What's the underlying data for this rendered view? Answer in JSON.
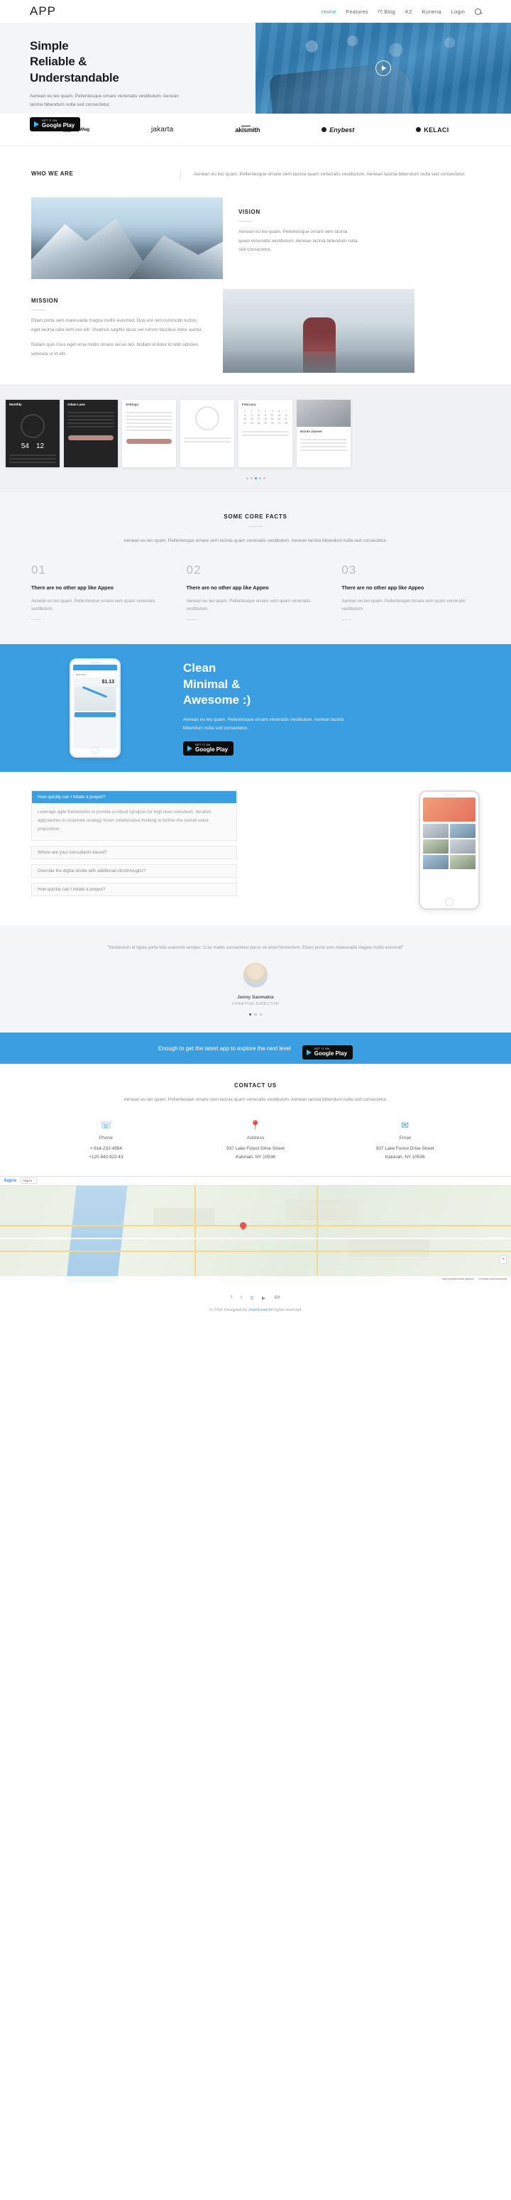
{
  "header": {
    "logo": "APP",
    "nav": [
      {
        "label": "Home",
        "active": true
      },
      {
        "label": "Features",
        "active": false
      },
      {
        "label": "Blog",
        "active": false,
        "icon": "joomla-icon"
      },
      {
        "label": "K2",
        "active": false
      },
      {
        "label": "Kunena",
        "active": false
      },
      {
        "label": "Login",
        "active": false
      }
    ],
    "search_icon": "search-icon"
  },
  "hero": {
    "title_line1": "Simple",
    "title_line2": "Reliable &",
    "title_line3": "Understandable",
    "paragraph": "Aenean eu leo quam. Pellentesque ornare venenatis vestibulum. Aenean lacinia bibendum nulla sed consectetur.",
    "store_badge": {
      "small": "GET IT ON",
      "big": "Google Play"
    },
    "play_button": "play-button"
  },
  "brands": [
    {
      "name": "TechMag",
      "mark": "TM"
    },
    {
      "name": "jakarta"
    },
    {
      "name": "akismith"
    },
    {
      "name": "Enybest"
    },
    {
      "name": "KELACI"
    }
  ],
  "who": {
    "heading": "WHO WE ARE",
    "paragraph": "Aenean eu leo quam. Pellentesque ornare sem lacinia quam venenatis vestibulum. Aenean lacinia bibendum nulla sed consectetur."
  },
  "vision": {
    "heading": "VISION",
    "paragraph": "Aenean eu leo quam. Pellentesque ornare sem lacinia quam venenatis vestibulum. Aenean lacinia bibendum nulla sed consectetur."
  },
  "mission": {
    "heading": "MISSION",
    "paragraph1": "Etiam porta sem malesuada magna mollis euismod. Duis est non commodo luctus, eget lacinia odio sem nec elit. Vivamus sagittis lacus vel rutrum faucibus dolor auctor.",
    "paragraph2": "Nullam quis risus eget urna mollis ornare vel eu leo. Nullam id dolor id nibh ultricies vehicula ut id elit."
  },
  "screens": {
    "items": [
      {
        "title": "Monthly",
        "kind": "dark-stats",
        "big1": "54",
        "big2": "12"
      },
      {
        "title": "Adam Lane",
        "kind": "dark-profile"
      },
      {
        "title": "Settings",
        "kind": "settings"
      },
      {
        "title": "",
        "kind": "circle"
      },
      {
        "title": "February",
        "kind": "calendar"
      },
      {
        "title": "Nicole Jameer",
        "kind": "photo-list"
      }
    ],
    "dots": 5,
    "active_dot": 2
  },
  "facts": {
    "heading": "SOME CORE FACTS",
    "lead": "Aenean eu leo quam. Pellentesque ornare sem lacinia quam venenatis vestibulum. Aenean lacinia bibendum nulla sed consectetur.",
    "items": [
      {
        "num": "01",
        "title": "There are no other app like Appeo",
        "text": "Aenean eu leo quam. Pellentesque ornare sem quam venenatis vestibulum."
      },
      {
        "num": "02",
        "title": "There are no other app like Appeo",
        "text": "Aenean eu leo quam. Pellentesque ornare sem quam venenatis vestibulum."
      },
      {
        "num": "03",
        "title": "There are no other app like Appeo",
        "text": "Aenean eu leo quam. Pellentesque ornare sem quam venenatis vestibulum."
      }
    ]
  },
  "blue": {
    "title_line1": "Clean",
    "title_line2": "Minimal &",
    "title_line3": "Awesome :)",
    "paragraph": "Aenean eu leo quam. Pellentesque ornare venenatis vestibulum. Aenean lacinia bibendum nulla sed consectetur.",
    "store_badge": {
      "small": "GET IT ON",
      "big": "Google Play"
    },
    "phone": {
      "price": "$1.13",
      "label": "Uber Price",
      "btn": "Find Now"
    }
  },
  "faq": {
    "items": [
      {
        "q": "How quickly can I intiate a project?",
        "open": true,
        "a": "Leverage agile frameworks to provide a robust synopsis for high level overviews. Iterative approaches to corporate strategy foster collaborative thinking to further the overall value proposition."
      },
      {
        "q": "Where are your consultants based?",
        "open": false,
        "a": ""
      },
      {
        "q": "Override the digital divide with additional clickthroughs?",
        "open": false,
        "a": ""
      },
      {
        "q": "How quickly can I intiate a project?",
        "open": false,
        "a": ""
      }
    ]
  },
  "testimonial": {
    "quote": "\"Vestibulum id ligula porta felis euismod semper. Cras mattis consectetur purus sit amet fermentum. Etiam porta sem malesuada magna mollis euismod\"",
    "name": "Jenny Sanmakia",
    "role": "CREATIVE DIRECTOR",
    "dots": 3,
    "active_dot": 0
  },
  "cta": {
    "text": "Enough to get the latest app to explore the next level",
    "store_badge": {
      "small": "GET IT ON",
      "big": "Google Play"
    }
  },
  "contact": {
    "heading": "CONTACT US",
    "lead": "Aenean eu leo quam. Pellentesque ornare sem lacinia quam venenatis vestibulum. Aenean lacinia bibendum nulla sed consectetur.",
    "columns": [
      {
        "icon": "phone-icon",
        "title": "Phone",
        "line1": "+ 914-232-4954",
        "line2": "+120 843 923 43"
      },
      {
        "icon": "location-pin-icon",
        "title": "Address",
        "line1": "937 Lake Forest Drive Street",
        "line2": "Katonah, NY 10536"
      },
      {
        "icon": "envelope-icon",
        "title": "Email",
        "line1": "937 Lake Forest Drive Street",
        "line2": "Katonah, NY 10536"
      }
    ]
  },
  "map": {
    "brand": "Карта",
    "selector": "Карта",
    "zoom_in": "+",
    "attribution": "Картографические данные",
    "terms": "Условия использования"
  },
  "footer": {
    "social": [
      {
        "name": "facebook-icon",
        "glyph": "f"
      },
      {
        "name": "twitter-icon",
        "glyph": "t"
      },
      {
        "name": "google-plus-icon",
        "glyph": "g"
      },
      {
        "name": "youtube-icon",
        "glyph": "▶"
      },
      {
        "name": "behance-icon",
        "glyph": "Bē"
      }
    ],
    "copyright_pre": "© 2016 Designed by ",
    "copyright_link": "JoomLead",
    "copyright_post": " All rights reserved"
  },
  "colors": {
    "accent": "#3a9ee0",
    "dark": "#1b1b1b",
    "muted": "#8b8b8b"
  }
}
